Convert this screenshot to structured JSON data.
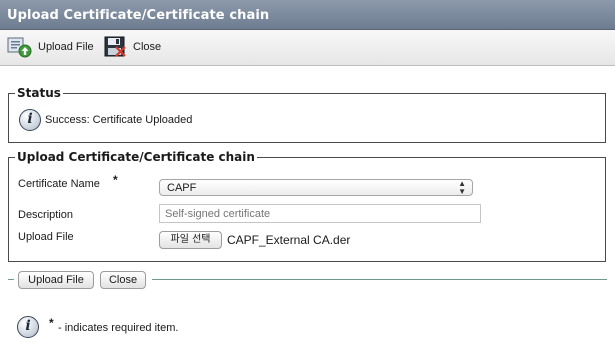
{
  "header": {
    "title": "Upload Certificate/Certificate chain"
  },
  "toolbar": {
    "upload_label": "Upload File",
    "close_label": "Close",
    "upload_icon": "upload-file-icon",
    "close_icon": "floppy-close-icon"
  },
  "status": {
    "legend": "Status",
    "message": "Success: Certificate Uploaded",
    "icon": "info-icon"
  },
  "upload_section": {
    "legend": "Upload Certificate/Certificate chain",
    "certificate_name_label": "Certificate Name",
    "required_marker": "*",
    "certificate_name_value": "CAPF",
    "description_label": "Description",
    "description_placeholder": "Self-signed certificate",
    "upload_file_label": "Upload File",
    "file_choose_button": "파일 선택",
    "file_name": "CAPF_External CA.der"
  },
  "actions": {
    "upload_button": "Upload File",
    "close_button": "Close"
  },
  "footer": {
    "required_marker": "*",
    "note": "- indicates required item.",
    "icon": "info-icon"
  },
  "colors": {
    "titlebar": "#7b889b",
    "divider": "#6f9a8a"
  }
}
